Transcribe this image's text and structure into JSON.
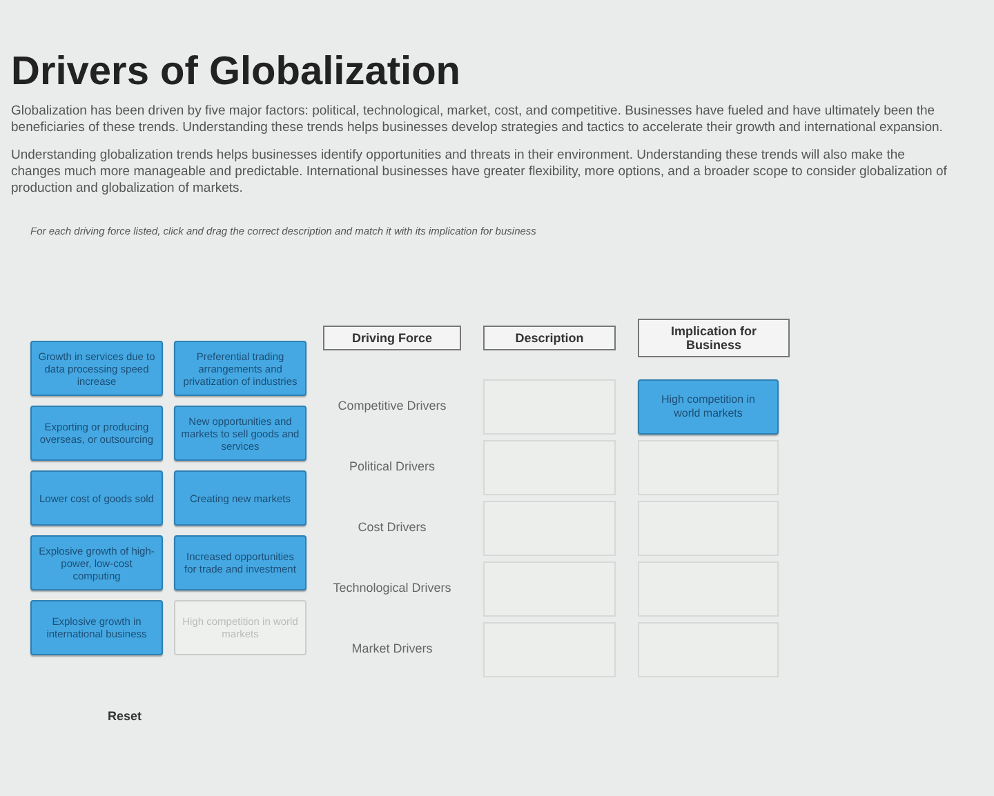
{
  "title": "Drivers of Globalization",
  "paragraphs": [
    "Globalization has been driven by five major factors: political, technological, market, cost, and competitive. Businesses have fueled and have ultimately been the beneficiaries of these trends. Understanding these trends helps businesses develop strategies and tactics to accelerate their growth and international expansion.",
    "Understanding globalization trends helps businesses identify opportunities and threats in their environment. Understanding these trends will also make the changes much more manageable and predictable. International businesses have greater flexibility, more options, and a broader scope to consider globalization of production and globalization of markets."
  ],
  "instruction": "For each driving force listed, click and drag the correct description and match it with its implication for business",
  "tiles": [
    {
      "text": "Growth in services due to data processing speed increase",
      "placed": false
    },
    {
      "text": "Preferential trading arrangements and privatization of industries",
      "placed": false
    },
    {
      "text": "Exporting or producing overseas, or outsourcing",
      "placed": false
    },
    {
      "text": "New opportunities and markets to sell goods and services",
      "placed": false
    },
    {
      "text": "Lower cost of goods sold",
      "placed": false
    },
    {
      "text": "Creating new markets",
      "placed": false
    },
    {
      "text": "Explosive growth of high-power, low-cost computing",
      "placed": false
    },
    {
      "text": "Increased opportunities for trade and investment",
      "placed": false
    },
    {
      "text": "Explosive growth in international business",
      "placed": false
    },
    {
      "text": "High competition in world markets",
      "placed": true
    }
  ],
  "columns": [
    "Driving Force",
    "Description",
    "Implication for Business"
  ],
  "rows": [
    {
      "driving_force": "Competitive Drivers",
      "implication": "High competition in world markets"
    },
    {
      "driving_force": "Political Drivers"
    },
    {
      "driving_force": "Cost Drivers"
    },
    {
      "driving_force": "Technological Drivers"
    },
    {
      "driving_force": "Market Drivers"
    }
  ],
  "reset": "Reset"
}
